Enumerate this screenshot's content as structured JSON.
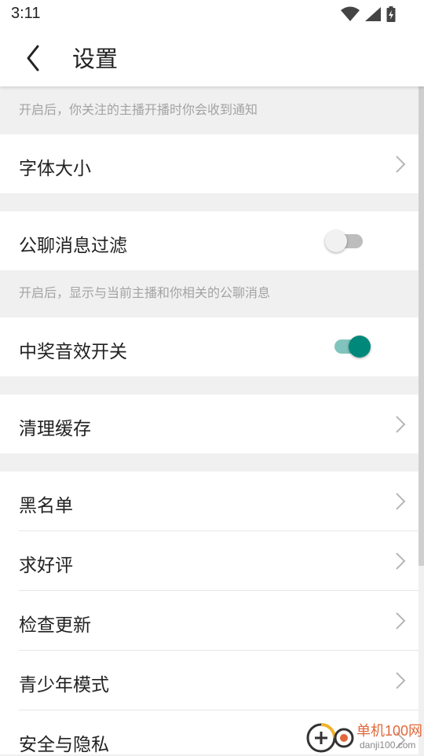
{
  "status_bar": {
    "time": "3:11",
    "icons": [
      "wifi-icon",
      "signal-icon",
      "battery-charging-icon"
    ]
  },
  "header": {
    "title": "设置",
    "back_icon": "chevron-left-icon"
  },
  "notes": {
    "top": "开启后，你关注的主播开播时你会收到通知",
    "chat_filter": "开启后，显示与当前主播和你相关的公聊消息"
  },
  "rows": {
    "font_size": "字体大小",
    "chat_filter": "公聊消息过滤",
    "win_sound": "中奖音效开关",
    "clear_cache": "清理缓存",
    "blacklist": "黑名单",
    "rate": "求好评",
    "check_update": "检查更新",
    "youth_mode": "青少年模式",
    "security": "安全与隐私"
  },
  "toggles": {
    "chat_filter_on": false,
    "win_sound_on": true
  },
  "colors": {
    "accent": "#00897B",
    "accent_track": "#80C4BD",
    "off_thumb": "#f1f1f1",
    "off_track": "#bdbdbd",
    "background": "#f0f0f0",
    "watermark": "#e0683a"
  },
  "watermark": {
    "brand": "单机100网",
    "domain": "danji100.com"
  }
}
